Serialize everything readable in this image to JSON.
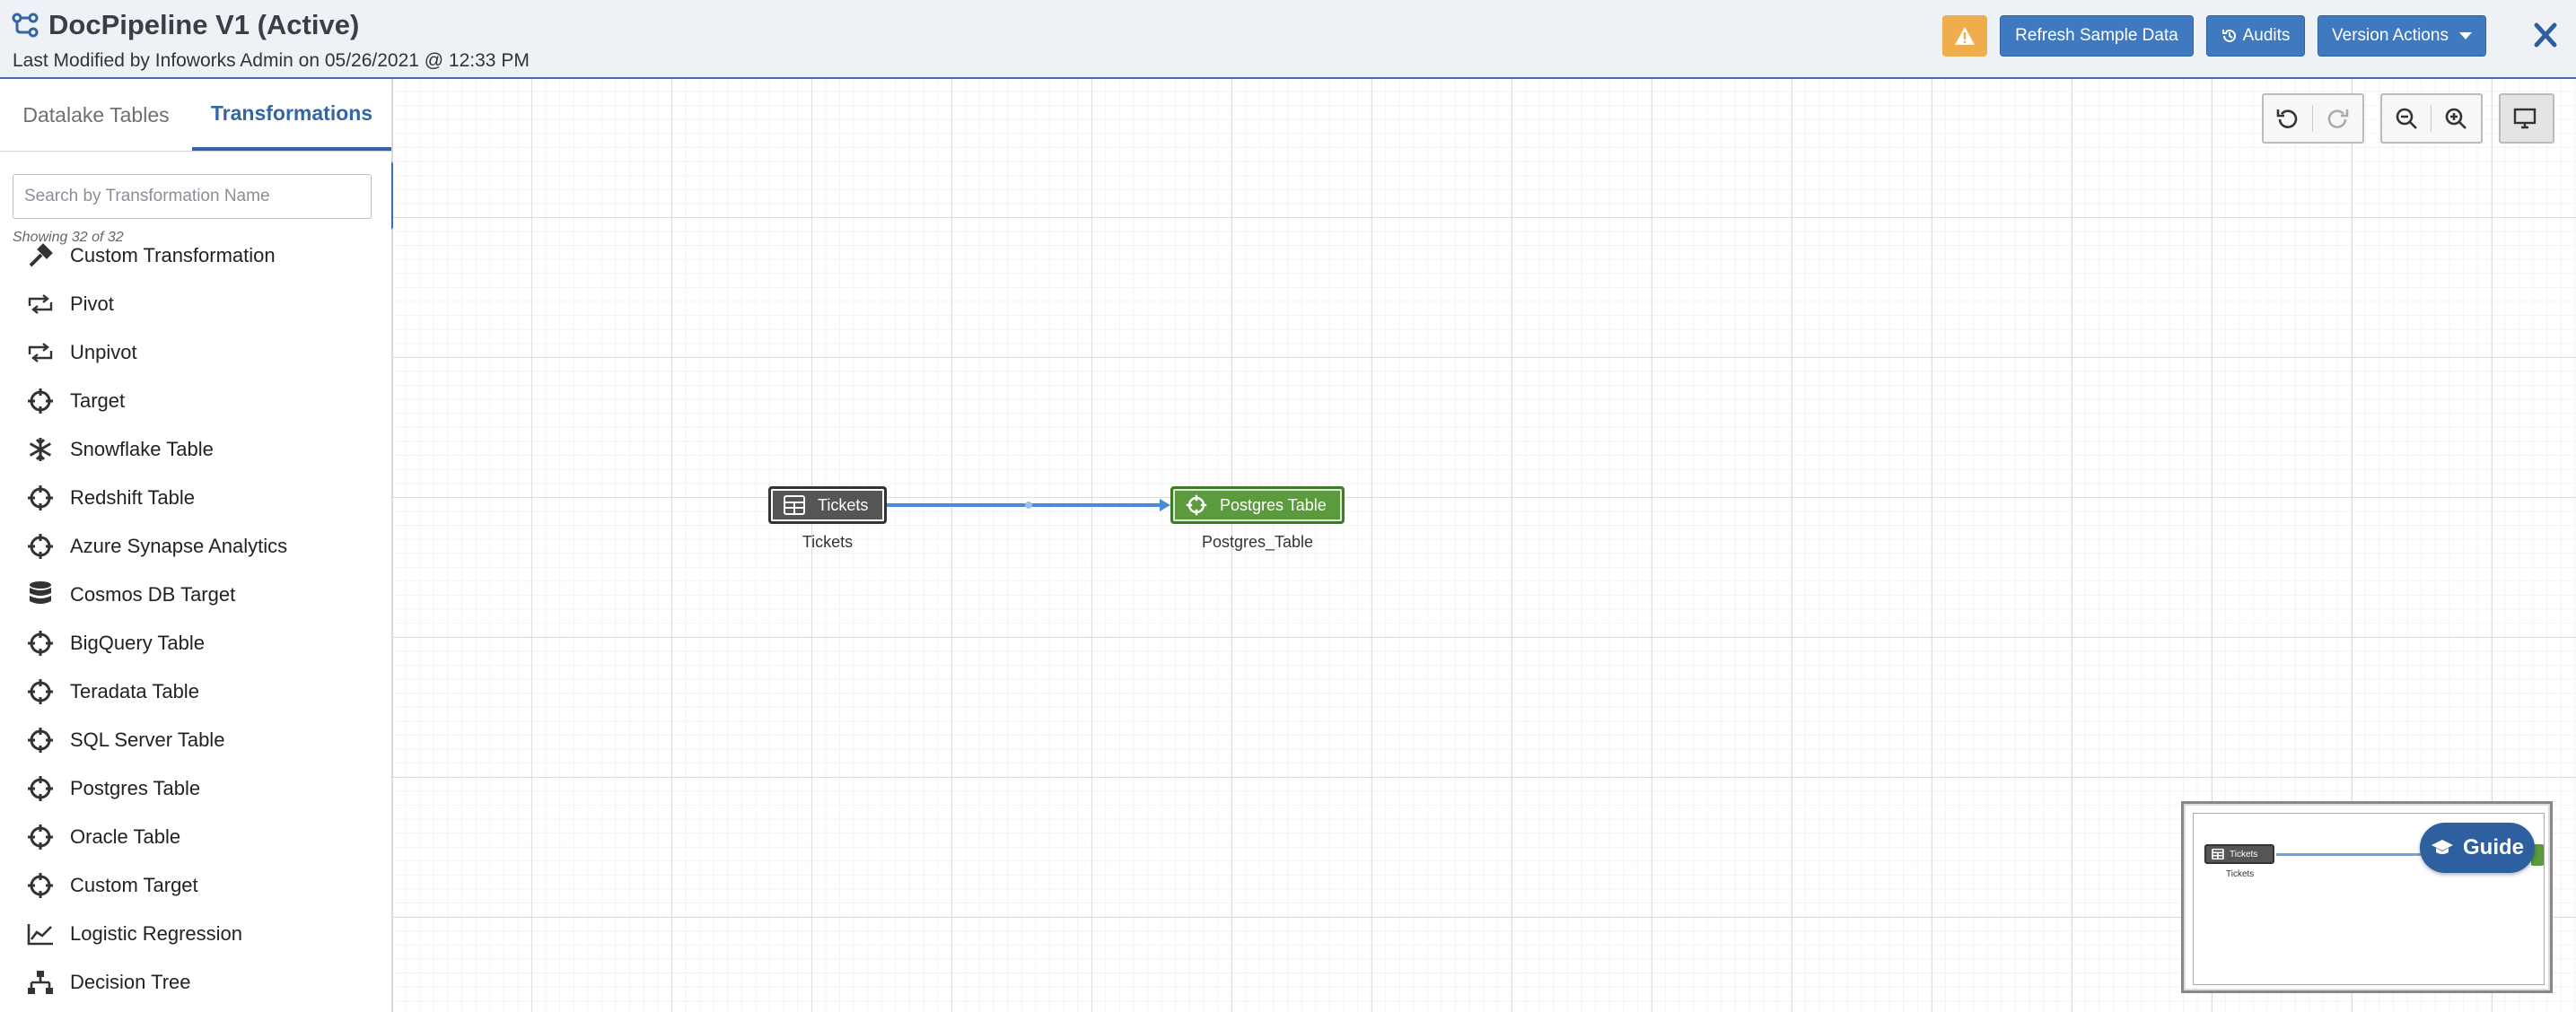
{
  "header": {
    "title": "DocPipeline V1 (Active)",
    "subtitle": "Last Modified by Infoworks Admin on 05/26/2021 @ 12:33 PM",
    "buttons": {
      "refresh": "Refresh Sample Data",
      "audits": "Audits",
      "version_actions": "Version Actions"
    }
  },
  "sidebar": {
    "tabs": [
      {
        "label": "Datalake Tables"
      },
      {
        "label": "Transformations"
      }
    ],
    "active_tab": "Transformations",
    "search": {
      "placeholder": "Search by Transformation Name",
      "value": ""
    },
    "showing": "Showing 32 of 32",
    "items": [
      {
        "label": "Custom Transformation",
        "icon": "wrench-icon"
      },
      {
        "label": "Pivot",
        "icon": "pivot-icon"
      },
      {
        "label": "Unpivot",
        "icon": "unpivot-icon"
      },
      {
        "label": "Target",
        "icon": "crosshair-icon"
      },
      {
        "label": "Snowflake Table",
        "icon": "snowflake-icon"
      },
      {
        "label": "Redshift Table",
        "icon": "crosshair-icon"
      },
      {
        "label": "Azure Synapse Analytics",
        "icon": "crosshair-icon"
      },
      {
        "label": "Cosmos DB Target",
        "icon": "database-icon"
      },
      {
        "label": "BigQuery Table",
        "icon": "crosshair-icon"
      },
      {
        "label": "Teradata Table",
        "icon": "crosshair-icon"
      },
      {
        "label": "SQL Server Table",
        "icon": "crosshair-icon"
      },
      {
        "label": "Postgres Table",
        "icon": "crosshair-icon"
      },
      {
        "label": "Oracle Table",
        "icon": "crosshair-icon"
      },
      {
        "label": "Custom Target",
        "icon": "crosshair-icon"
      },
      {
        "label": "Logistic Regression",
        "icon": "line-chart-icon"
      },
      {
        "label": "Decision Tree",
        "icon": "tree-icon"
      }
    ]
  },
  "canvas": {
    "nodes": [
      {
        "label": "Tickets",
        "caption": "Tickets",
        "color": "#555555"
      },
      {
        "label": "Postgres Table",
        "caption": "Postgres_Table",
        "color": "#5b9a3d"
      }
    ],
    "minimap": {
      "node_label": "Tickets",
      "node_caption": "Tickets"
    }
  },
  "guide": {
    "label": "Guide"
  },
  "colors": {
    "accent": "#3f79c0",
    "warning": "#f0ad4e",
    "target_node": "#5b9a3d",
    "source_node": "#555555",
    "edge": "#4a8ad8"
  }
}
